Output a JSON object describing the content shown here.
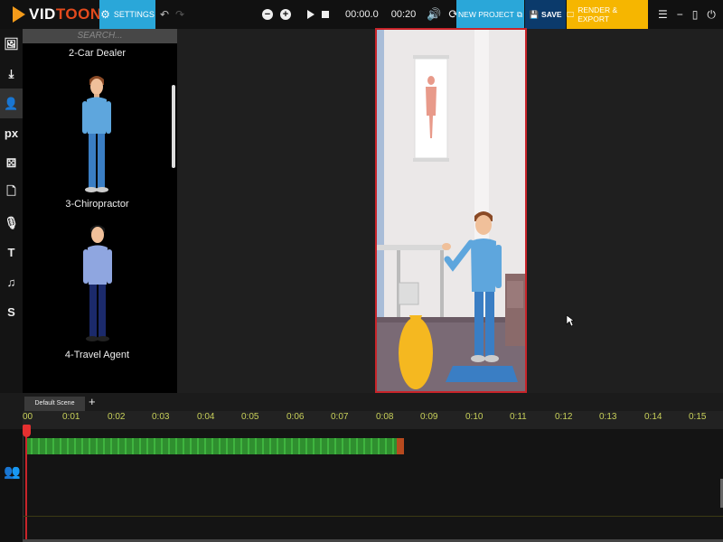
{
  "app": {
    "logo_part1": "VID",
    "logo_part2": "TOON",
    "brand_colors": {
      "logo_orange": "#f39a1a",
      "logo_red": "#e34a1d",
      "accent_blue": "#2aa7d9",
      "save_navy": "#0b3a6b",
      "render_yellow": "#f6b600",
      "playhead_red": "#c8242a"
    }
  },
  "toolbar": {
    "settings_label": "SETTINGS",
    "current_time": "00:00.0",
    "total_time": "00:20",
    "new_project_label": "NEW PROJECT",
    "save_label": "SAVE",
    "render_label": "RENDER & EXPORT",
    "icons": [
      "gear-icon",
      "undo-icon",
      "redo-icon",
      "zoom-out-icon",
      "zoom-in-icon",
      "play-icon",
      "stop-icon",
      "volume-icon",
      "loop-icon",
      "external-link-icon",
      "floppy-icon",
      "monitor-icon",
      "menu-icon",
      "minimize-icon",
      "window-icon",
      "power-icon"
    ]
  },
  "rail": {
    "items": [
      {
        "name": "image-icon",
        "glyph": "🖾",
        "active": false
      },
      {
        "name": "download-icon",
        "glyph": "⤓",
        "active": false
      },
      {
        "name": "person-icon",
        "glyph": "👤",
        "active": true
      },
      {
        "name": "px-icon",
        "glyph": "px",
        "active": false
      },
      {
        "name": "props-icon",
        "glyph": "⚄",
        "active": false
      },
      {
        "name": "document-icon",
        "glyph": "🗋",
        "active": false
      },
      {
        "name": "microphone-icon",
        "glyph": "🎙",
        "active": false
      },
      {
        "name": "text-icon",
        "glyph": "T",
        "active": false
      },
      {
        "name": "music-icon",
        "glyph": "♫",
        "active": false
      },
      {
        "name": "s-icon",
        "glyph": "S",
        "active": false
      }
    ]
  },
  "panel": {
    "search_placeholder": "SEARCH...",
    "characters": [
      {
        "label": "2-Car Dealer"
      },
      {
        "label": "3-Chiropractor"
      },
      {
        "label": "4-Travel Agent"
      }
    ]
  },
  "timeline": {
    "scene_tab": "Default Scene",
    "add_scene": "+",
    "ticks": [
      "00",
      "0:01",
      "0:02",
      "0:03",
      "0:04",
      "0:05",
      "0:06",
      "0:07",
      "0:08",
      "0:09",
      "0:10",
      "0:11",
      "0:12",
      "0:13",
      "0:14",
      "0:15"
    ]
  }
}
